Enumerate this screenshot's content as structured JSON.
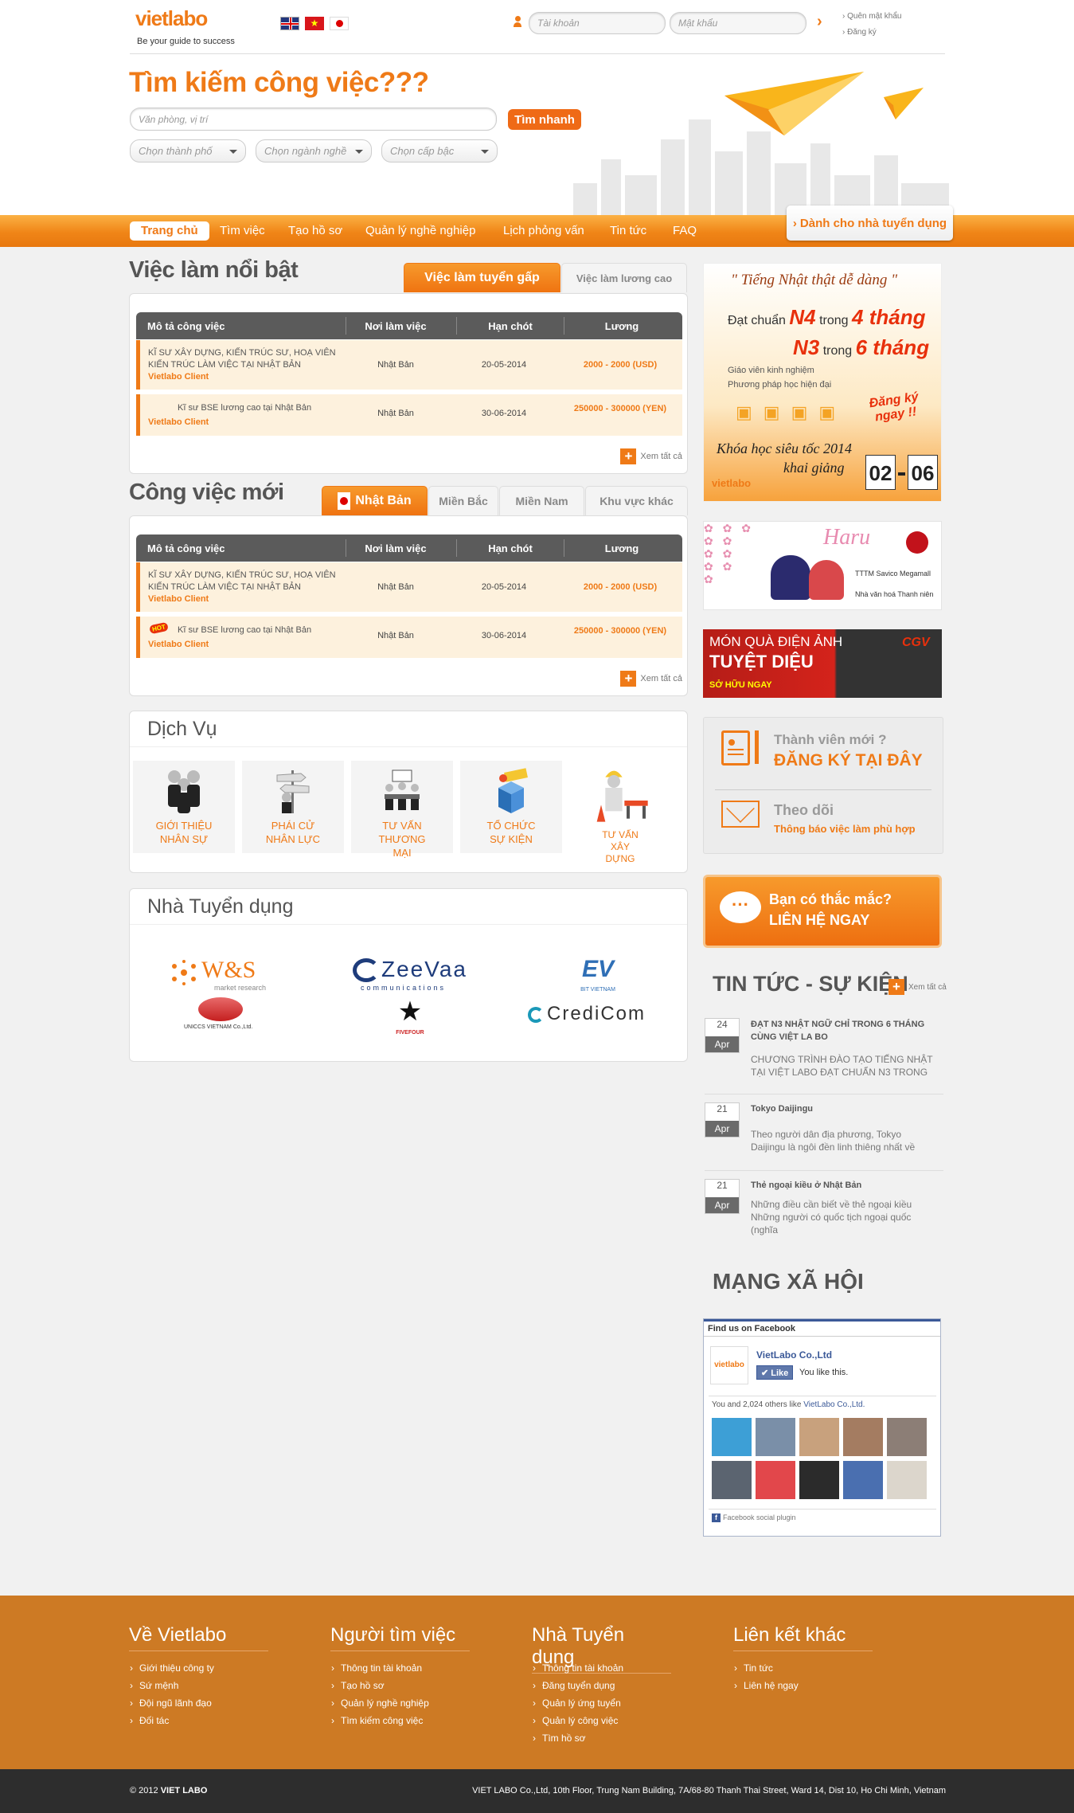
{
  "header": {
    "logo": "vietlabo",
    "tagline": "Be your guide to success",
    "username_placeholder": "Tài khoản",
    "password_placeholder": "Mật khẩu",
    "forgot_password": "Quên mật khẩu",
    "register": "Đăng ký"
  },
  "search": {
    "title": "Tìm kiếm công việc???",
    "placeholder": "Văn phòng, vị trí",
    "button": "Tìm nhanh",
    "city": "Chọn thành phố",
    "industry": "Chọn ngành nghề",
    "level": "Chọn cấp bậc"
  },
  "nav": {
    "items": [
      "Trang chủ",
      "Tìm việc",
      "Tạo hồ sơ",
      "Quản lý nghề nghiệp",
      "Lịch phỏng vấn",
      "Tin tức",
      "FAQ"
    ],
    "employer": "Dành cho nhà tuyển dụng"
  },
  "featured": {
    "title": "Việc làm nổi bật",
    "tabs": [
      "Việc làm tuyển gấp",
      "Việc làm lương cao"
    ],
    "columns": [
      "Mô tả công việc",
      "Nơi làm việc",
      "Hạn chót",
      "Lương"
    ],
    "rows": [
      {
        "title": "KĨ SƯ XÂY DỰNG, KIẾN TRÚC SƯ, HOẠ VIÊN KIẾN TRÚC LÀM VIỆC TẠI NHẬT BẢN",
        "company": "Vietlabo Client",
        "place": "Nhật Bản",
        "deadline": "20-05-2014",
        "salary": "2000 - 2000 (USD)"
      },
      {
        "title": "Kĩ sư BSE lương cao tại Nhật Bản",
        "company": "Vietlabo Client",
        "place": "Nhật Bản",
        "deadline": "30-06-2014",
        "salary": "250000 - 300000 (YEN)"
      }
    ],
    "more": "Xem tất cả"
  },
  "newjobs": {
    "title": "Công việc mới",
    "tabs": [
      "Nhật Bản",
      "Miền Bắc",
      "Miền Nam",
      "Khu vực khác"
    ],
    "columns": [
      "Mô tả công việc",
      "Nơi làm việc",
      "Hạn chót",
      "Lương"
    ],
    "rows": [
      {
        "title": "KĨ SƯ XÂY DỰNG, KIẾN TRÚC SƯ, HOẠ VIÊN KIẾN TRÚC LÀM VIỆC TẠI NHẬT BẢN",
        "company": "Vietlabo Client",
        "place": "Nhật Bản",
        "deadline": "20-05-2014",
        "salary": "2000 - 2000 (USD)"
      },
      {
        "title": "Kĩ sư BSE lương cao tại Nhật Bản",
        "company": "Vietlabo Client",
        "place": "Nhật Bản",
        "deadline": "30-06-2014",
        "salary": "250000 - 300000 (YEN)"
      }
    ],
    "hot": "HOT",
    "more": "Xem tất cả"
  },
  "services": {
    "title": "Dịch Vụ",
    "items": [
      "GIỚI THIỆU NHÂN SỰ",
      "PHÁI CỬ NHÂN LỰC",
      "TƯ VẤN THƯƠNG MẠI",
      "TỔ CHỨC SỰ KIỆN",
      "TƯ VẤN XÂY DỰNG"
    ]
  },
  "employers": {
    "title": "Nhà Tuyển dụng",
    "logos": [
      "W&S",
      "market research",
      "UNICCS VIETNAM Co.,Ltd.",
      "ZeeVaa",
      "communications",
      "FIVEFOUR",
      "BIT VIETNAM",
      "CrediCom"
    ]
  },
  "ads": {
    "course_quote": "\" Tiếng Nhật thật dễ dàng \"",
    "line1_a": "Đạt chuẩn",
    "line1_b": "N4",
    "line1_c": "trong",
    "line1_d": "4 tháng",
    "line2_b": "N3",
    "line2_c": "trong",
    "line2_d": "6 tháng",
    "bullet1": "Giáo viên kinh nghiệm",
    "bullet2": "Phương pháp học hiện đại",
    "cta": "Đăng ký ngay !!",
    "khoa": "Khóa học siêu tốc 2014",
    "khai": "khai giảng",
    "d1": "02",
    "d2": "06",
    "haru": "Haru",
    "haru_l1": "TTTM Savico Megamall",
    "haru_l2": "Nhà văn hoá Thanh niên",
    "cgv1": "MÓN QUÀ ĐIỆN ẢNH",
    "cgv2": "TUYỆT DIỆU",
    "cgv3": "SỞ HỮU NGAY",
    "cgv_logo": "CGV"
  },
  "member": {
    "q": "Thành viên mới ?",
    "cta": "ĐĂNG KÝ TẠI ĐÂY",
    "follow": "Theo dõi",
    "follow_sub": "Thông báo việc làm phù hợp"
  },
  "contact": {
    "q": "Bạn có thắc mắc?",
    "cta": "LIÊN HỆ NGAY"
  },
  "news": {
    "title": "TIN TỨC - SỰ KIỆN",
    "more": "Xem tất cả",
    "items": [
      {
        "day": "24",
        "mon": "Apr",
        "title": "ĐẠT N3 NHẬT NGỮ CHỈ TRONG 6 THÁNG CÙNG VIỆT LA BO",
        "desc": "CHƯƠNG TRÌNH ĐÀO TẠO TIẾNG NHẬT TẠI VIỆT LABO ĐẠT CHUẨN N3 TRONG"
      },
      {
        "day": "21",
        "mon": "Apr",
        "title": "Tokyo Daijingu",
        "desc": "Theo người dân địa phương, Tokyo Daijingu là ngôi đền linh thiêng nhất về"
      },
      {
        "day": "21",
        "mon": "Apr",
        "title": "Thẻ ngoại kiều ở Nhật Bản",
        "desc": "Những điều cần biết về thẻ ngoại kiều Những người có quốc tịch ngoại quốc (nghĩa"
      }
    ]
  },
  "social": {
    "title": "MẠNG XÃ HỘI",
    "fb_head": "Find us on Facebook",
    "page": "VietLabo Co.,Ltd",
    "like": "Like",
    "you_like": "You like this.",
    "others": "You and 2,024 others like",
    "others_link": "VietLabo Co.,Ltd.",
    "plugin": "Facebook social plugin"
  },
  "footer": {
    "cols": [
      {
        "h": "Về Vietlabo",
        "items": [
          "Giới thiệu công ty",
          "Sứ mệnh",
          "Đội ngũ lãnh đạo",
          "Đối tác"
        ]
      },
      {
        "h": "Người tìm việc",
        "items": [
          "Thông tin tài khoản",
          "Tạo hồ sơ",
          "Quản lý nghề nghiệp",
          "Tìm kiếm công việc"
        ]
      },
      {
        "h": "Nhà Tuyển dụng",
        "items": [
          "Thông tin tài khoản",
          "Đăng tuyển dụng",
          "Quản lý ứng tuyển",
          "Quản lý công việc",
          "Tìm hồ sơ"
        ]
      },
      {
        "h": "Liên kết khác",
        "items": [
          "Tin tức",
          "Liên hệ ngay"
        ]
      }
    ],
    "copy_pre": "© 2012",
    "copy_brand": "VIET LABO",
    "address": "VIET LABO Co.,Ltd, 10th Floor, Trung Nam Building, 7A/68-80 Thanh Thai Street, Ward 14, Dist 10, Ho Chi Minh, Vietnam"
  }
}
